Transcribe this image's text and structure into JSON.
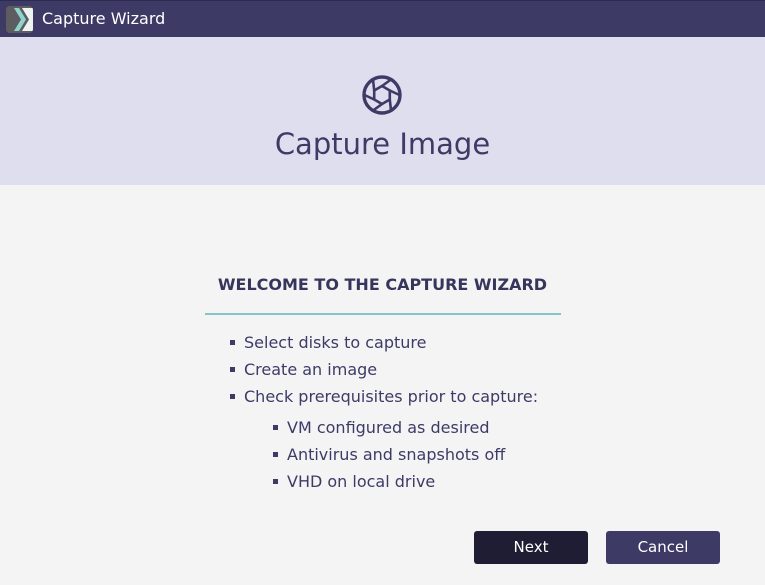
{
  "window": {
    "title": "Capture Wizard",
    "app_icon": "wizard-app-icon"
  },
  "header": {
    "icon": "camera-shutter-icon",
    "title": "Capture Image"
  },
  "welcome": {
    "heading": "WELCOME TO THE CAPTURE WIZARD",
    "steps": [
      "Select disks to capture",
      "Create an image",
      "Check prerequisites prior to capture:"
    ],
    "prerequisites": [
      "VM configured as desired",
      "Antivirus and snapshots off",
      "VHD on local drive"
    ]
  },
  "buttons": {
    "next_label": "Next",
    "cancel_label": "Cancel"
  },
  "colors": {
    "title_bar": "#3d3b66",
    "header_band": "#dfdeee",
    "accent_divider": "#84c6c3",
    "primary_button": "#1f1d33",
    "secondary_button": "#3d3b66"
  }
}
